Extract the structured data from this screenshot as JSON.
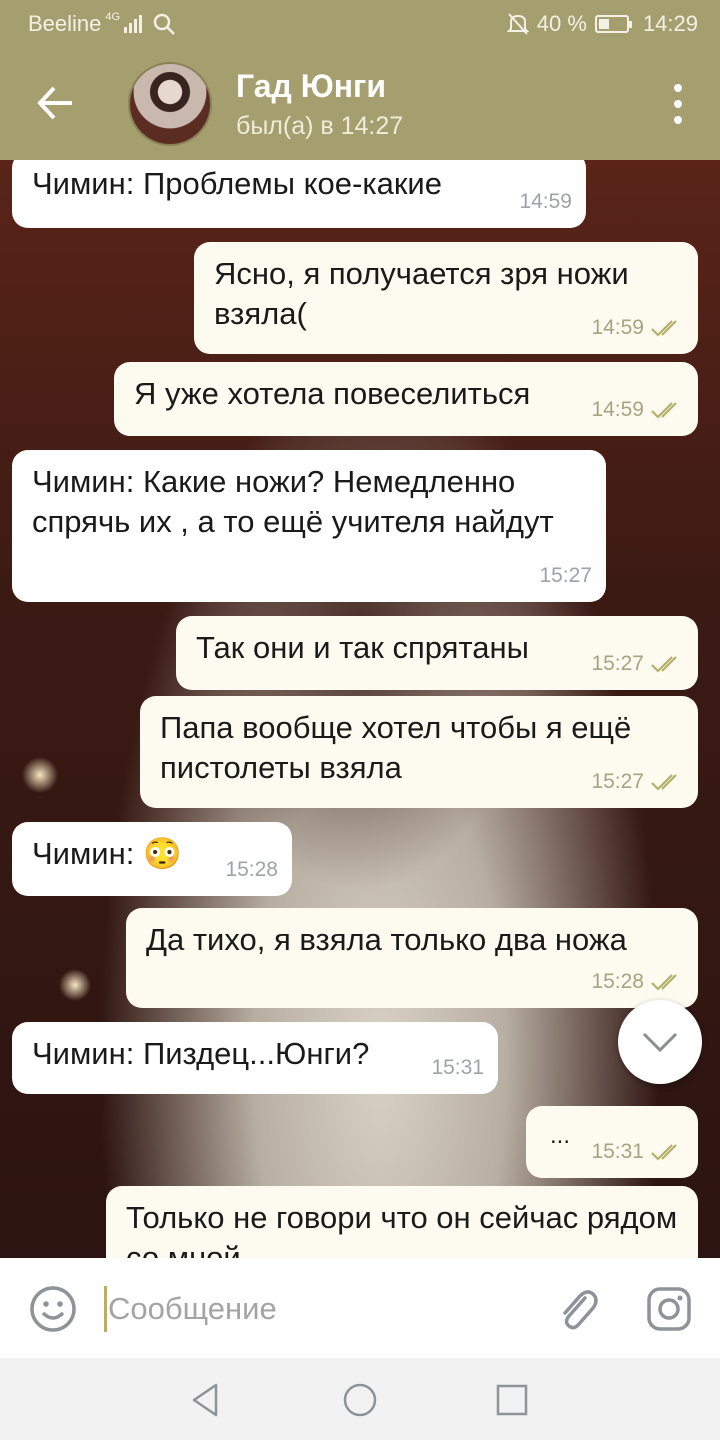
{
  "status_bar": {
    "carrier": "Beeline",
    "network": "4G",
    "battery": "40 %",
    "battery_level": 0.4,
    "time": "14:29"
  },
  "header": {
    "title": "Гад Юнги",
    "status": "был(а) в 14:27"
  },
  "messages": [
    {
      "direction": "in",
      "text": "Чимин: Проблемы кое-какие",
      "time": "14:59"
    },
    {
      "direction": "out",
      "text": "Ясно, я получается зря ножи взяла(",
      "time": "14:59",
      "read": true
    },
    {
      "direction": "out",
      "text": "Я уже хотела повеселиться",
      "time": "14:59",
      "read": true
    },
    {
      "direction": "in",
      "text": "Чимин: Какие ножи? Немедленно спрячь их , а то ещё учителя найдут",
      "time": "15:27"
    },
    {
      "direction": "out",
      "text": "Так они и так спрятаны",
      "time": "15:27",
      "read": true
    },
    {
      "direction": "out",
      "text": "Папа вообще хотел чтобы я ещё пистолеты взяла",
      "time": "15:27",
      "read": true
    },
    {
      "direction": "in",
      "text": "Чимин: 😳",
      "time": "15:28"
    },
    {
      "direction": "out",
      "text": "Да тихо, я взяла только два ножа",
      "time": "15:28",
      "read": true
    },
    {
      "direction": "in",
      "text": "Чимин: Пиздец...Юнги?",
      "time": "15:31"
    },
    {
      "direction": "out",
      "text": "...",
      "time": "15:31",
      "read": true
    },
    {
      "direction": "out",
      "text": "Только не говори что он сейчас рядом со мной",
      "time": "",
      "read": false
    }
  ],
  "input": {
    "placeholder": "Сообщение"
  },
  "colors": {
    "header": "#a59f6f",
    "bubble_in": "#ffffff",
    "bubble_out": "#fdfaf0",
    "check": "#b3b06a"
  },
  "icons": [
    "back-arrow-icon",
    "menu-dots-icon",
    "emoji-icon",
    "attach-icon",
    "camera-icon",
    "chevron-down-icon",
    "nav-back-icon",
    "nav-home-icon",
    "nav-recents-icon"
  ]
}
